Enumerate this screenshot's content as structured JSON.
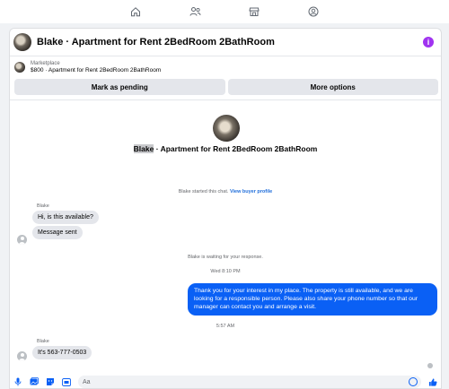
{
  "nav": {
    "items": [
      {
        "icon": "home-icon"
      },
      {
        "icon": "people-icon"
      },
      {
        "icon": "marketplace-icon"
      },
      {
        "icon": "groups-icon"
      }
    ]
  },
  "header": {
    "title": "Blake · Apartment for Rent 2BedRoom 2BathRoom",
    "info_icon": "i"
  },
  "marketplace": {
    "label": "Marketplace",
    "listing": "$800 · Apartment for Rent 2BedRoom 2BathRoom"
  },
  "actions": {
    "pending": "Mark as pending",
    "more": "More options"
  },
  "hero": {
    "name": "Blake",
    "title_rest": " · Apartment for Rent 2BedRoom 2BathRoom"
  },
  "system": {
    "started": "Blake started this chat.",
    "view_profile": "View buyer profile",
    "waiting": "Blake is waiting for your response."
  },
  "messages": {
    "sender1": "Blake",
    "msg1": "Hi, is this available?",
    "msg2": "Message sent",
    "time1": "Wed 8:10 PM",
    "outgoing": "Thank you for your interest in my place. The property is still available, and we are looking for a responsible person. Please also share your phone number so that our manager can contact you and arrange a visit.",
    "time2": "5:57 AM",
    "sender2": "Blake",
    "msg3": "It's 563-777-0503"
  },
  "composer": {
    "placeholder": "Aa"
  },
  "colors": {
    "accent": "#0a60f5",
    "info": "#a033f0",
    "link": "#216fdb"
  }
}
